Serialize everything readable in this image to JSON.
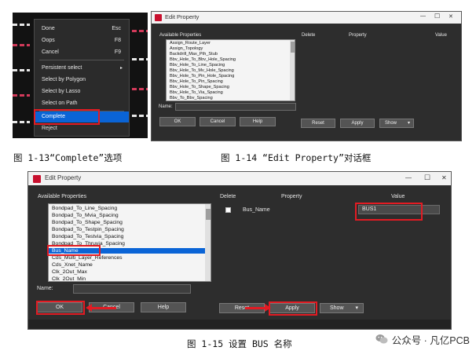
{
  "fig13": {
    "menu_items": [
      {
        "label": "Done",
        "key": "Esc"
      },
      {
        "label": "Oops",
        "key": "F8"
      },
      {
        "label": "Cancel",
        "key": "F9"
      },
      {
        "label": "Persistent select",
        "key": ""
      },
      {
        "label": "Select by Polygon",
        "key": ""
      },
      {
        "label": "Select by Lasso",
        "key": ""
      },
      {
        "label": "Select on Path",
        "key": ""
      },
      {
        "label": "Complete",
        "key": ""
      },
      {
        "label": "Reject",
        "key": ""
      }
    ],
    "submenu_arrow": "▸",
    "highlight_color": "#0a64d6"
  },
  "fig14": {
    "title": "Edit Property",
    "headers": {
      "available": "Available Properties",
      "delete": "Delete",
      "property": "Property",
      "value": "Value"
    },
    "list_items": [
      "Assign_Route_Layer",
      "Assign_Topology",
      "Backdrill_Max_Pth_Stub",
      "Bbv_Hole_To_Bbv_Hole_Spacing",
      "Bbv_Hole_To_Line_Spacing",
      "Bbv_Hole_To_Mv_Hole_Spacing",
      "Bbv_Hole_To_Pin_Hole_Spacing",
      "Bbv_Hole_To_Pin_Spacing",
      "Bbv_Hole_To_Shape_Spacing",
      "Bbv_Hole_To_Via_Spacing",
      "Bbv_To_Bbv_Spacing"
    ],
    "name_label": "Name:",
    "buttons": {
      "ok": "OK",
      "cancel": "Cancel",
      "help": "Help",
      "reset": "Reset",
      "apply": "Apply",
      "show": "Show"
    },
    "show_arrow": "▾",
    "window_controls": {
      "minimize": "—",
      "maximize": "☐",
      "close": "✕"
    }
  },
  "fig15": {
    "title": "Edit Property",
    "headers": {
      "available": "Available Properties",
      "delete": "Delete",
      "property": "Property",
      "value": "Value"
    },
    "list_items": [
      "Bondpad_To_Line_Spacing",
      "Bondpad_To_Mvia_Spacing",
      "Bondpad_To_Shape_Spacing",
      "Bondpad_To_Testpin_Spacing",
      "Bondpad_To_Testvia_Spacing",
      "Bondpad_To_Thruvia_Spacing",
      "Bus_Name",
      "Cds_Multi_Layer_References",
      "Cds_Xnet_Name",
      "Clk_2Out_Max",
      "Clk_2Out_Min"
    ],
    "selected_index": 6,
    "row": {
      "property": "Bus_Name",
      "value": "BUS1"
    },
    "name_label": "Name:",
    "buttons": {
      "ok": "OK",
      "cancel": "Cancel",
      "help": "Help",
      "reset": "Reset",
      "apply": "Apply",
      "show": "Show"
    },
    "show_arrow": "▾",
    "window_controls": {
      "minimize": "—",
      "maximize": "☐",
      "close": "✕"
    }
  },
  "captions": {
    "fig13": "图 1-13“Complete”选项",
    "fig14": "图 1-14 “Edit Property”对话框",
    "fig15": "图 1-15 设置 BUS 名称"
  },
  "watermark": {
    "text": "公众号 · 凡亿PCB",
    "icon": "wechat-icon"
  },
  "colors": {
    "annotation_red": "#e31b23",
    "selection_blue": "#0a64d6",
    "dialog_bg": "#2d2d2d"
  }
}
